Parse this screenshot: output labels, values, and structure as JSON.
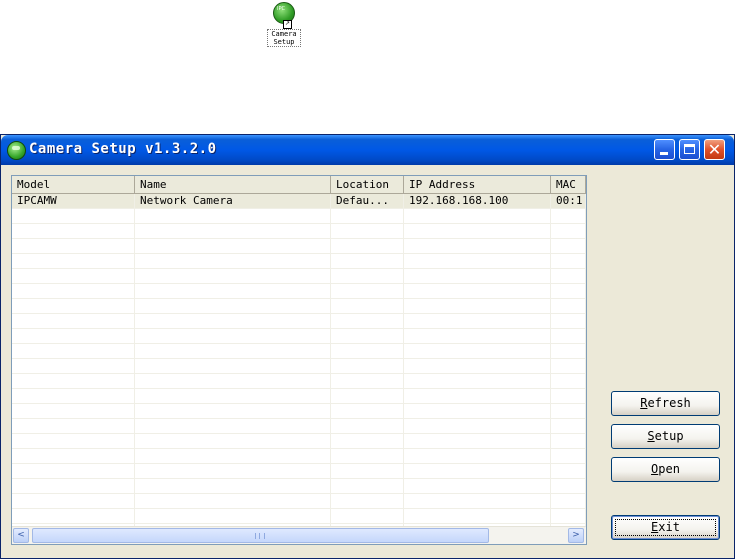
{
  "desktop_icon": {
    "caption_line1": "Camera",
    "caption_line2": "Setup",
    "glyph_text": "IPC"
  },
  "window": {
    "title": "Camera Setup v1.3.2.0",
    "controls": {
      "minimize": "_",
      "maximize": "□",
      "close": "✕"
    }
  },
  "list": {
    "columns": [
      "Model",
      "Name",
      "Location",
      "IP Address",
      "MAC"
    ],
    "rows": [
      {
        "model": "IPCAMW",
        "name": "Network Camera",
        "location": "Defau...",
        "ip": "192.168.168.100",
        "mac": "00:1"
      }
    ],
    "empty_rows": 23
  },
  "scrollbar": {
    "left_arrow": "<",
    "right_arrow": ">"
  },
  "buttons": {
    "refresh": {
      "accel": "R",
      "rest": "efresh"
    },
    "setup": {
      "accel": "S",
      "rest": "etup"
    },
    "open": {
      "accel": "O",
      "rest": "pen"
    },
    "exit": {
      "accel": "E",
      "rest": "xit"
    }
  }
}
